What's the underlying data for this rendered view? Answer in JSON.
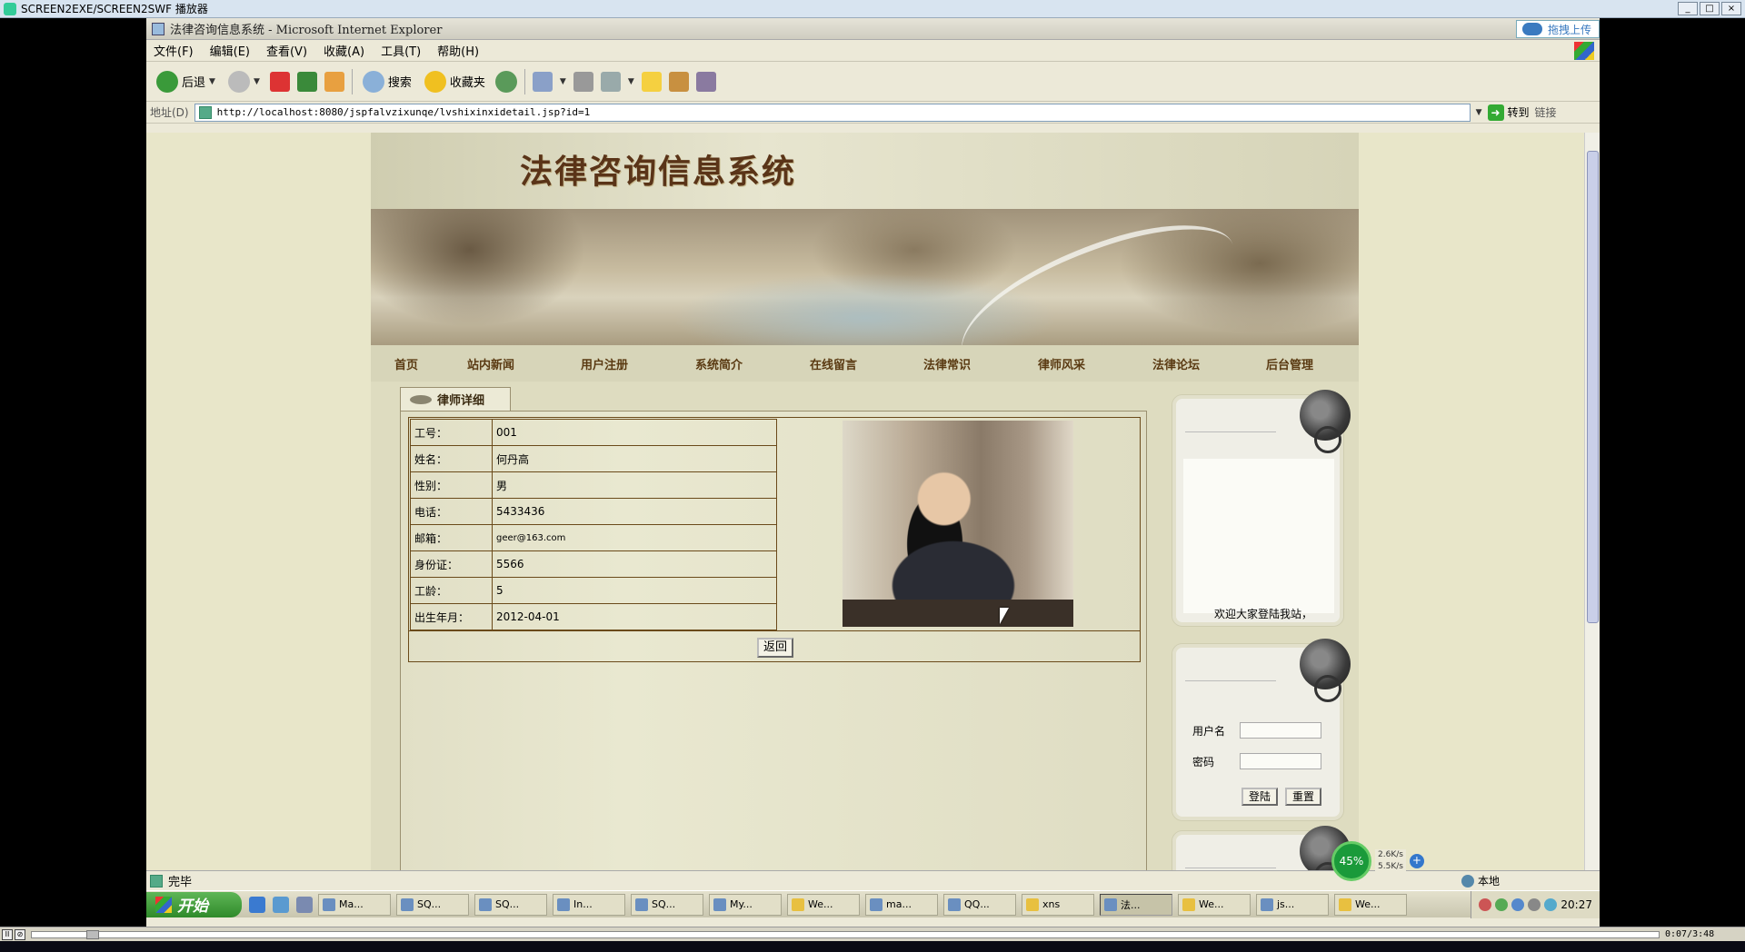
{
  "player": {
    "title": "SCREEN2EXE/SCREEN2SWF 播放器",
    "time": "0:07/3:48"
  },
  "browser": {
    "window_title": "法律咨询信息系统 - Microsoft Internet Explorer",
    "upload_label": "拖拽上传",
    "menu": [
      "文件(F)",
      "编辑(E)",
      "查看(V)",
      "收藏(A)",
      "工具(T)",
      "帮助(H)"
    ],
    "toolbar": {
      "back": "后退",
      "search": "搜索",
      "favorites": "收藏夹"
    },
    "address_label": "地址(D)",
    "url": "http://localhost:8080/jspfalvzixunqe/lvshixinxidetail.jsp?id=1",
    "go_label": "转到",
    "links_label": "链接",
    "status_text": "完毕",
    "zone_text": "本地"
  },
  "site": {
    "title": "法律咨询信息系统",
    "nav": [
      "首页",
      "站内新闻",
      "用户注册",
      "系统简介",
      "在线留言",
      "法律常识",
      "律师风采",
      "法律论坛",
      "后台管理"
    ],
    "section_tab": "律师详细",
    "detail_rows": [
      {
        "label": "工号：",
        "value": "001"
      },
      {
        "label": "姓名：",
        "value": "何丹高"
      },
      {
        "label": "性别：",
        "value": "男"
      },
      {
        "label": "电话：",
        "value": "5433436"
      },
      {
        "label": "邮箱：",
        "value": "geer@163.com"
      },
      {
        "label": "身份证：",
        "value": "5566"
      },
      {
        "label": "工龄：",
        "value": "5"
      },
      {
        "label": "出生年月：",
        "value": "2012-04-01"
      }
    ],
    "back_button": "返回",
    "welcome_text": "欢迎大家登陆我站，",
    "login": {
      "username_label": "用户名",
      "password_label": "密码",
      "login_button": "登陆",
      "reset_button": "重置"
    }
  },
  "network": {
    "percent": "45%",
    "up": "2.6K/s",
    "down": "5.5K/s"
  },
  "taskbar": {
    "start_label": "开始",
    "tasks": [
      "Ma...",
      "SQ...",
      "SQ...",
      "In...",
      "SQ...",
      "My...",
      "We...",
      "ma...",
      "QQ...",
      "xns",
      "法...",
      "We...",
      "js...",
      "We..."
    ],
    "clock": "20:27"
  }
}
